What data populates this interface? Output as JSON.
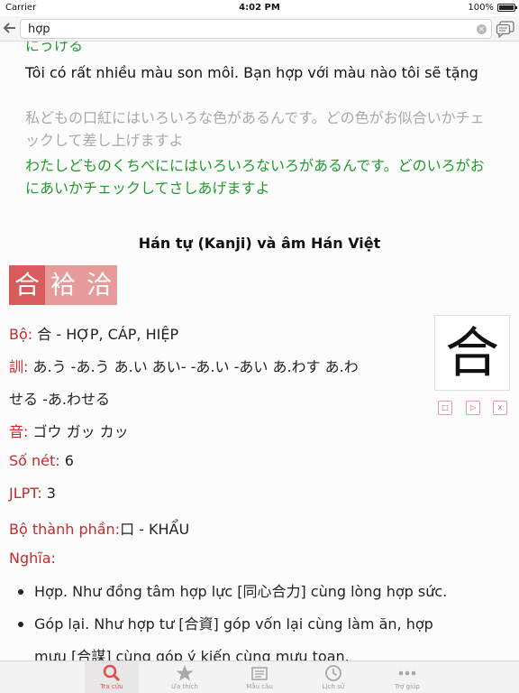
{
  "status_bar": {
    "carrier": "Carrier",
    "time": "4:02 PM",
    "battery": "100%"
  },
  "search": {
    "value": "hợp"
  },
  "examples": {
    "cut_top_line": "にうける",
    "vi_line": "Tôi có rất nhiều màu son môi. Bạn hợp với màu nào tôi sẽ tặng",
    "jp_line": "私どもの口紅にはいろいろな色があるんです。どの色がお似合いかチェックして差し上げますよ",
    "kana_line": "わたしどものくちべににはいろいろないろがあるんです。どのいろがおにあいかチェックしてさしあげますよ"
  },
  "section_title": "Hán tự (Kanji) và âm Hán Việt",
  "kanji_tabs": [
    "合",
    "袷",
    "洽"
  ],
  "kanji": {
    "character": "合",
    "bo_label": "Bộ:",
    "bo_value": "合 - HỢP, CÁP, HIỆP",
    "kun_label": "訓:",
    "kun_value_1": "あ.う -あ.う あ.い あい- -あ.い -あい あ.わす あ.わ",
    "kun_value_2": "せる -あ.わせる",
    "on_label": "音:",
    "on_value": "ゴウ ガッ カッ",
    "strokes_label": "Số nét:",
    "strokes_value": "6",
    "jlpt_label": "JLPT:",
    "jlpt_value": "3",
    "parts_label": "Bộ thành phần:",
    "parts_value": "口 - KHẨU",
    "meaning_label": "Nghĩa:",
    "meanings": [
      "Hợp. Như đồng tâm hợp lực [同心合力] cùng lòng hợp sức.",
      "Góp lại. Như hợp tư [合資] góp vốn lại cùng làm ăn, hợp",
      "mưu [合謀] cùng góp ý kiến cùng mưu toan."
    ],
    "stroke_controls": [
      "□",
      "▷",
      "x"
    ]
  },
  "tabs": [
    {
      "label": "Tra cứu",
      "icon": "search-icon"
    },
    {
      "label": "Ưa thích",
      "icon": "star-icon"
    },
    {
      "label": "Mẫu câu",
      "icon": "sentences-icon"
    },
    {
      "label": "Lịch sử",
      "icon": "clock-icon"
    },
    {
      "label": "Trợ giúp",
      "icon": "more-icon"
    }
  ],
  "colors": {
    "accent": "#d95c5c",
    "green": "#1f9a2a",
    "label_red": "#c72a2a"
  }
}
